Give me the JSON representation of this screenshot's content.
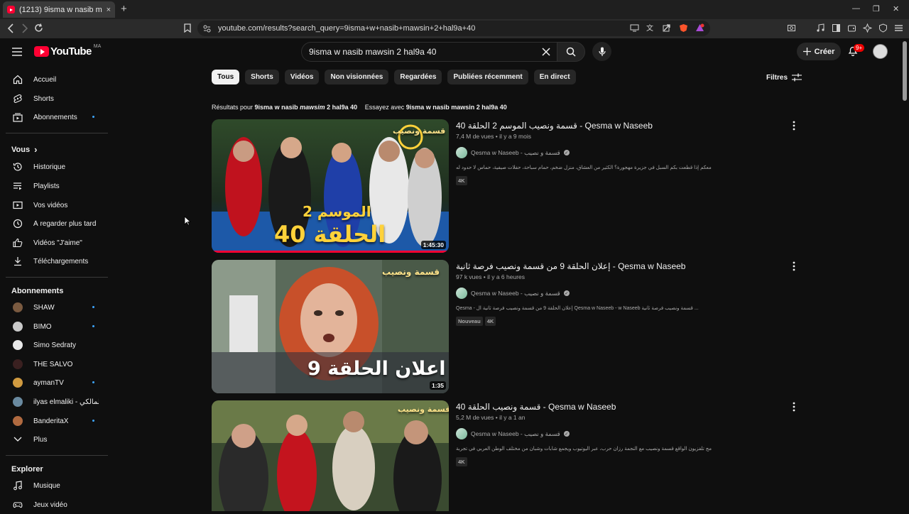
{
  "browser": {
    "tab_title": "(1213) 9isma w nasib mawsin 2 hal9a 40 - YouTube",
    "tab_close": "×",
    "new_tab": "+",
    "url": "youtube.com/results?search_query=9isma+w+nasib+mawsin+2+hal9a+40",
    "window_min": "—",
    "window_max": "❐",
    "window_close": "✕"
  },
  "header": {
    "logo_text": "YouTube",
    "country_code": "MA",
    "search_value": "9isma w nasib mawsin 2 hal9a 40",
    "create_label": "Créer",
    "notifications_count": "9+"
  },
  "sidebar": {
    "main": [
      {
        "label": "Accueil",
        "icon": "home-icon"
      },
      {
        "label": "Shorts",
        "icon": "shorts-icon"
      },
      {
        "label": "Abonnements",
        "icon": "subscriptions-icon"
      }
    ],
    "you_heading": "Vous",
    "you_chevron": "›",
    "you": [
      {
        "label": "Historique",
        "icon": "history-icon"
      },
      {
        "label": "Playlists",
        "icon": "playlists-icon"
      },
      {
        "label": "Vos vidéos",
        "icon": "your-videos-icon"
      },
      {
        "label": "À regarder plus tard",
        "icon": "watch-later-icon"
      },
      {
        "label": "Vidéos \"J'aime\"",
        "icon": "like-icon"
      },
      {
        "label": "Téléchargements",
        "icon": "download-icon"
      }
    ],
    "subs_heading": "Abonnements",
    "subs": [
      {
        "label": "SHAW",
        "color": "#7a5a40"
      },
      {
        "label": "BIMO",
        "color": "#c9c9c9"
      },
      {
        "label": "Simo Sedraty",
        "color": "#e8e8e8"
      },
      {
        "label": "THE SALVO",
        "color": "#3a2020"
      },
      {
        "label": "aymanTV",
        "color": "#d09a40"
      },
      {
        "label": "ilyas elmaliki - الياس المالكي",
        "color": "#6a8aa0"
      },
      {
        "label": "BanderitaX",
        "color": "#b06a40"
      }
    ],
    "more_label": "Plus",
    "explore_heading": "Explorer",
    "explore": [
      {
        "label": "Musique",
        "icon": "music-icon"
      },
      {
        "label": "Jeux vidéo",
        "icon": "gaming-icon"
      }
    ]
  },
  "chips": [
    "Tous",
    "Shorts",
    "Vidéos",
    "Non visionnées",
    "Regardées",
    "Publiées récemment",
    "En direct"
  ],
  "filters_label": "Filtres",
  "results_line": {
    "prefix": "Résultats pour",
    "query_a": "9isma w nasib",
    "query_b": "mawsim",
    "query_c": "2 hal9a 40",
    "try_prefix": "Essayez avec",
    "try_query": "9isma w nasib mawsin 2 hal9a 40"
  },
  "videos": [
    {
      "title": "قسمة ونصيب الموسم 2 الحلقة 40 - Qesma w Naseeb",
      "meta": "7,4 M de vues • il y a 9 mois",
      "channel": "Qesma w Naseeb - قسمة و نصيب",
      "description": "ماذا ستفعلون معكم إذا قطعت بكم السبل في جزيرة مهجورة؟ الكثير من العشاق، منزل ضخم، حمام سباحة، حفلات صيفية، حماس لا حدود له!",
      "badges": [
        "4K"
      ],
      "duration": "1:45:30",
      "thumb_line1": "الموسم 2",
      "thumb_line2": "الحلقة 40",
      "logo_text": "قسمة ونصيب"
    },
    {
      "title": "إعلان الحلقة 9 من قسمة ونصيب فرصة ثانية - Qesma w Naseeb",
      "meta": "97 k vues • il y a 6 heures",
      "channel": "Qesma w Naseeb - قسمة و نصيب",
      "description": "Qesma - إعلان الحلقة 9 من قسمة ونصيب فرصة ثانية ال Qesma w Naseeb - w Naseeb قسمة ونصيب فرصة ثانية ...",
      "badges": [
        "Nouveau",
        "4K"
      ],
      "duration": "1:35",
      "thumb_line1": "اعلان الحلقة 9",
      "logo_text": "قسمة ونصيب"
    },
    {
      "title": "قسمة ونصيب الحلقة 40 - Qesma w Naseeb",
      "meta": "5,2 M de vues • il y a 1 an",
      "channel": "Qesma w Naseeb - قسمة و نصيب",
      "description": "انطلق برنامج تلفزيون الواقع قسمة ونصيب مع النجمة رزان حرب، عبر اليوتيوب ويجمع شابات وشبان من مختلف الوطن العربي في تجربة ...",
      "badges": [
        "4K"
      ],
      "logo_text": "قسمة ونصيب"
    }
  ],
  "colors": {
    "background": "#0f0f0f",
    "brand_red": "#ff0033",
    "chip_bg": "#272727",
    "link_blue": "#3ea6ff"
  }
}
